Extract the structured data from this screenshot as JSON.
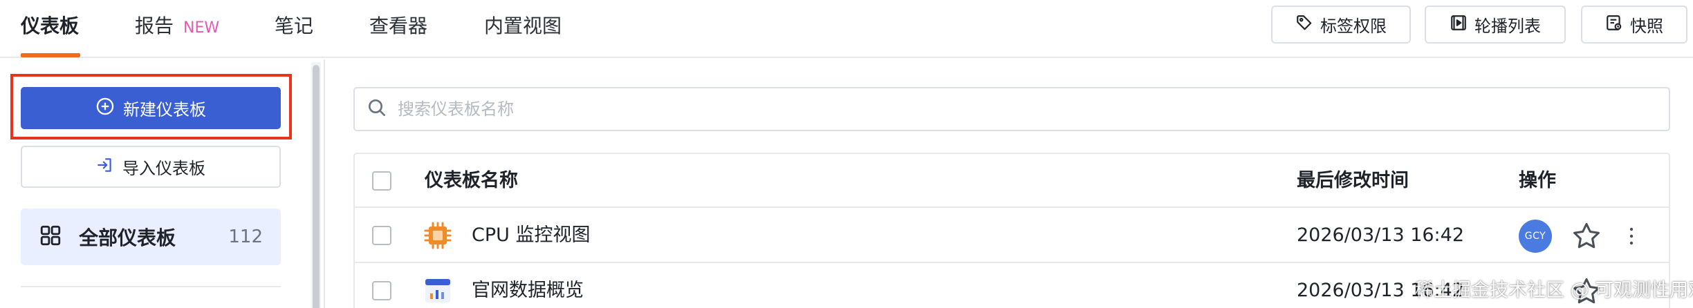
{
  "topnav": {
    "tabs": [
      {
        "label": "仪表板",
        "active": true
      },
      {
        "label": "报告",
        "badge": "NEW"
      },
      {
        "label": "笔记"
      },
      {
        "label": "查看器"
      },
      {
        "label": "内置视图"
      }
    ],
    "actions": [
      {
        "label": "标签权限",
        "icon": "tag-icon"
      },
      {
        "label": "轮播列表",
        "icon": "play-icon"
      },
      {
        "label": "快照",
        "icon": "snapshot-icon"
      }
    ]
  },
  "sidebar": {
    "create_label": "新建仪表板",
    "import_label": "导入仪表板",
    "all_label": "全部仪表板",
    "all_count": "112"
  },
  "search": {
    "placeholder": "搜索仪表板名称"
  },
  "table": {
    "headers": {
      "name": "仪表板名称",
      "modified": "最后修改时间",
      "actions": "操作"
    },
    "rows": [
      {
        "name": "CPU 监控视图",
        "time": "2026/03/13 16:42",
        "owner": "GCY",
        "icon": "cpu-icon"
      },
      {
        "name": "官网数据概览",
        "time": "2026/03/13 16:42",
        "icon": "chart-window-icon"
      }
    ]
  },
  "watermark": "稀土掘金技术社区 @ 可观测性用观测云",
  "colors": {
    "accent": "#3a5fd3",
    "tab_underline": "#f26b1d",
    "new_badge": "#e65ab3",
    "highlight_border": "#e8341c",
    "selected_bg": "#e9efff"
  }
}
